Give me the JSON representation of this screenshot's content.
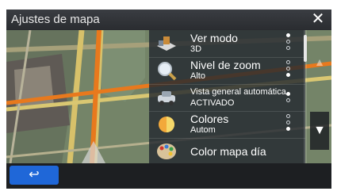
{
  "window": {
    "title": "Ajustes de mapa",
    "close_glyph": "✕",
    "close_icon": "close-icon"
  },
  "menu": {
    "items": [
      {
        "label": "Ver modo",
        "value": "3D",
        "icon": "view-mode-icon",
        "options": 3,
        "selected": 0
      },
      {
        "label": "Nivel de zoom",
        "value": "Alto",
        "icon": "zoom-magnifier-icon",
        "options": 3,
        "selected": 2
      },
      {
        "label": "Vista general automática",
        "value": "ACTIVADO",
        "icon": "auto-overview-car-icon",
        "options": 2,
        "selected": 0
      },
      {
        "label": "Colores",
        "value": "Autom",
        "icon": "colors-day-night-icon",
        "options": 3,
        "selected": 2
      },
      {
        "label": "Color mapa día",
        "value": "",
        "icon": "palette-icon"
      }
    ]
  },
  "scroll": {
    "down_glyph": "▼",
    "up_glyph": "▲",
    "down_icon": "scroll-down-icon",
    "up_icon": "scroll-up-icon"
  },
  "footer": {
    "back_glyph": "↩",
    "back_icon": "back-arrow-icon"
  },
  "colors": {
    "accent": "#1f67d8",
    "route": "#e8791d",
    "panel": "#232830"
  }
}
